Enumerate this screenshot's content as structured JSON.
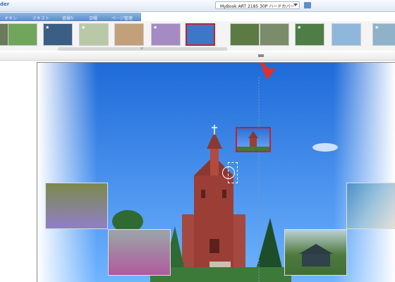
{
  "app": {
    "logo": "der"
  },
  "product_select": {
    "value": "MyBook ART 2185 30P ハードカバー"
  },
  "tabs": [
    {
      "label": "- オキシ"
    },
    {
      "label": "テキスト"
    },
    {
      "label": "背景fr"
    },
    {
      "label": "日曜"
    },
    {
      "label": "ページ管理"
    }
  ],
  "thumbnails": [
    {
      "name": "park-rocks",
      "color": "#6c7a5c",
      "star": false
    },
    {
      "name": "green-field",
      "color": "#6fa65c",
      "star": false
    },
    {
      "name": "radial-sky",
      "color": "#3b5e85",
      "star": true
    },
    {
      "name": "gallery-wall",
      "color": "#b9c9a8",
      "star": true
    },
    {
      "name": "food-plate",
      "color": "#c2a07a",
      "star": false
    },
    {
      "name": "purple-flowers",
      "color": "#a48bc3",
      "star": true
    },
    {
      "name": "church-sky",
      "color": "#3c78c8",
      "star": false,
      "selected": true
    },
    {
      "name": "tree-walk",
      "color": "#5c7a44",
      "star": false
    },
    {
      "name": "tree-cabin",
      "color": "#7a8c6a",
      "star": false
    },
    {
      "name": "barn-field",
      "color": "#4e7d45",
      "star": true
    },
    {
      "name": "meadow-sky",
      "color": "#8fb7dc",
      "star": false
    },
    {
      "name": "gallery-blue",
      "color": "#8fb2c9",
      "star": true
    }
  ],
  "colors": {
    "accent": "#3b6fb8",
    "selection": "#c8202a",
    "arrow": "#e0302a",
    "sky": "#2d7fe0"
  }
}
